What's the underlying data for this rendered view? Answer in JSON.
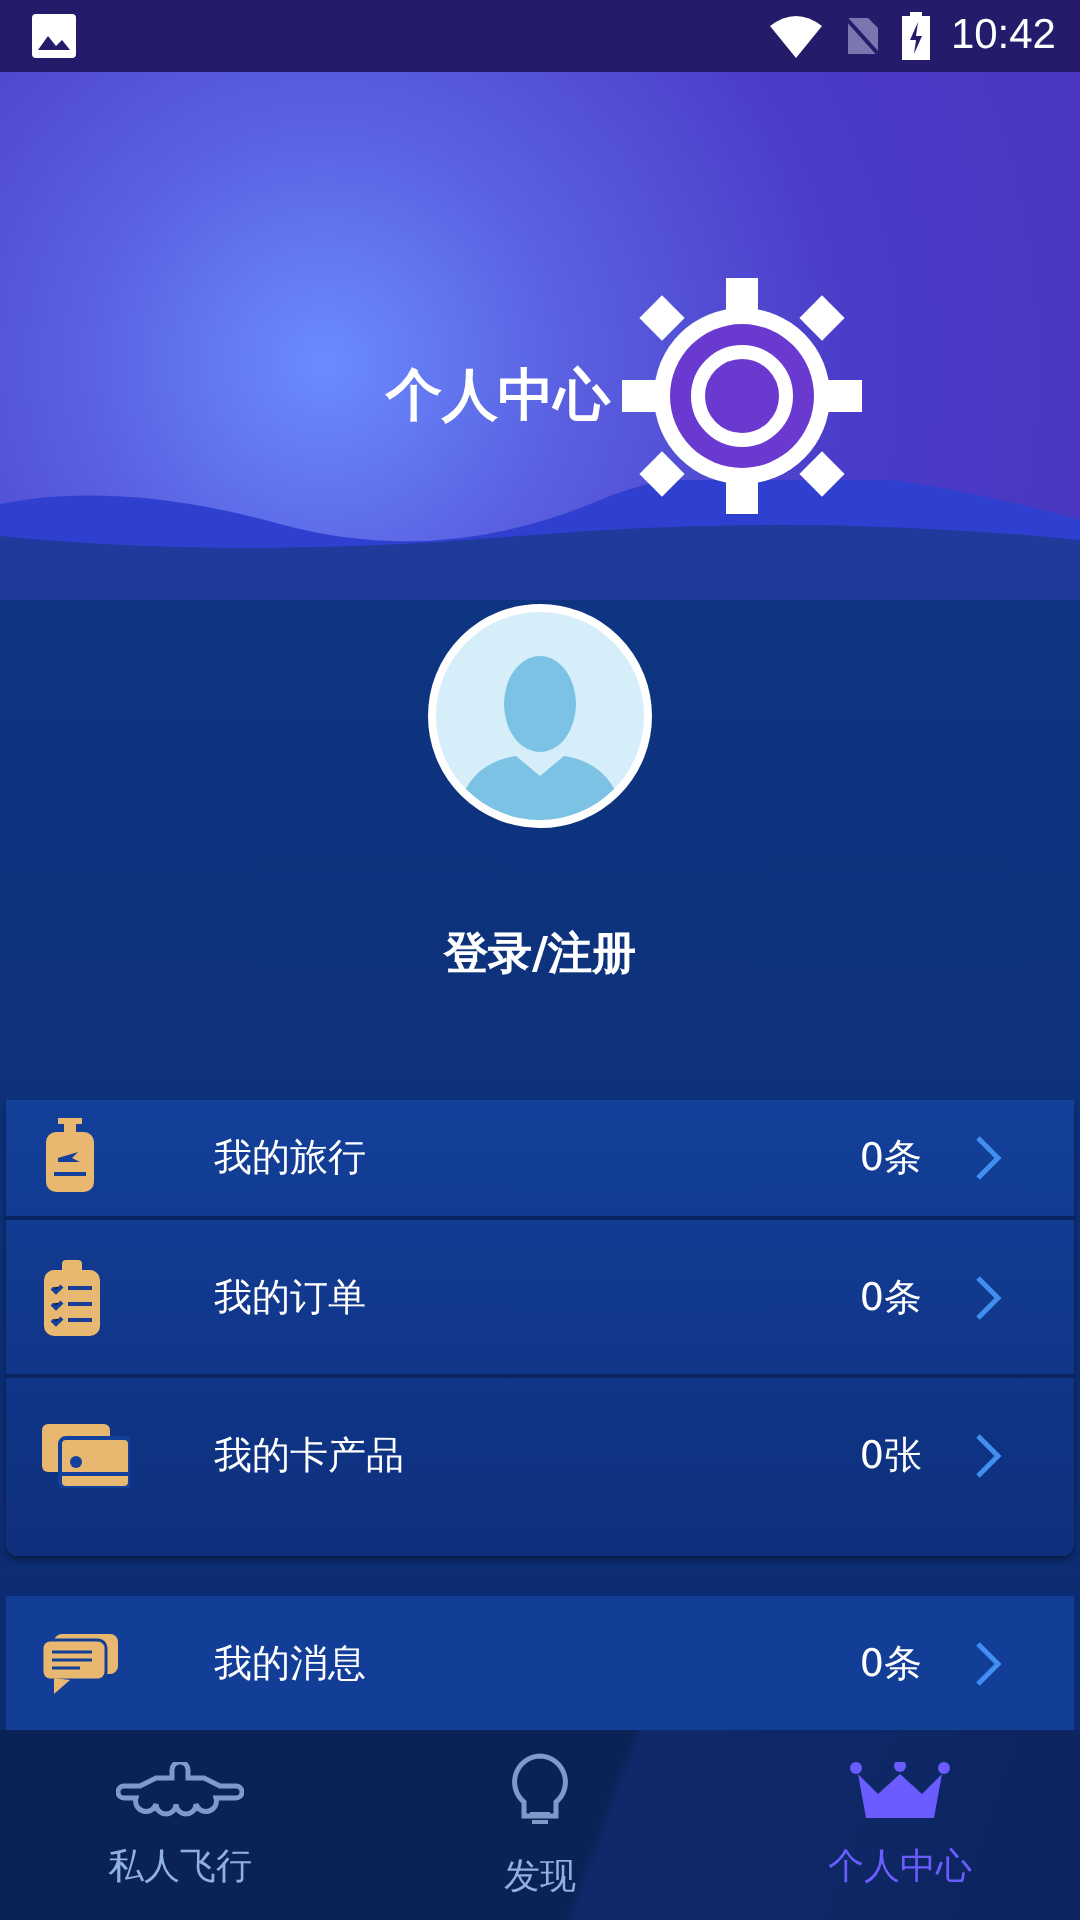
{
  "status_bar": {
    "time": "10:42"
  },
  "header": {
    "title": "个人中心"
  },
  "profile": {
    "login_label": "登录/注册"
  },
  "menu_card": [
    {
      "label": "我的旅行",
      "count": "0条"
    },
    {
      "label": "我的订单",
      "count": "0条"
    },
    {
      "label": "我的卡产品",
      "count": "0张"
    }
  ],
  "message_card": {
    "label": "我的消息",
    "count": "0条"
  },
  "tabs": [
    {
      "label": "私人飞行",
      "selected": false
    },
    {
      "label": "发现",
      "selected": false
    },
    {
      "label": "个人中心",
      "selected": true
    }
  ]
}
